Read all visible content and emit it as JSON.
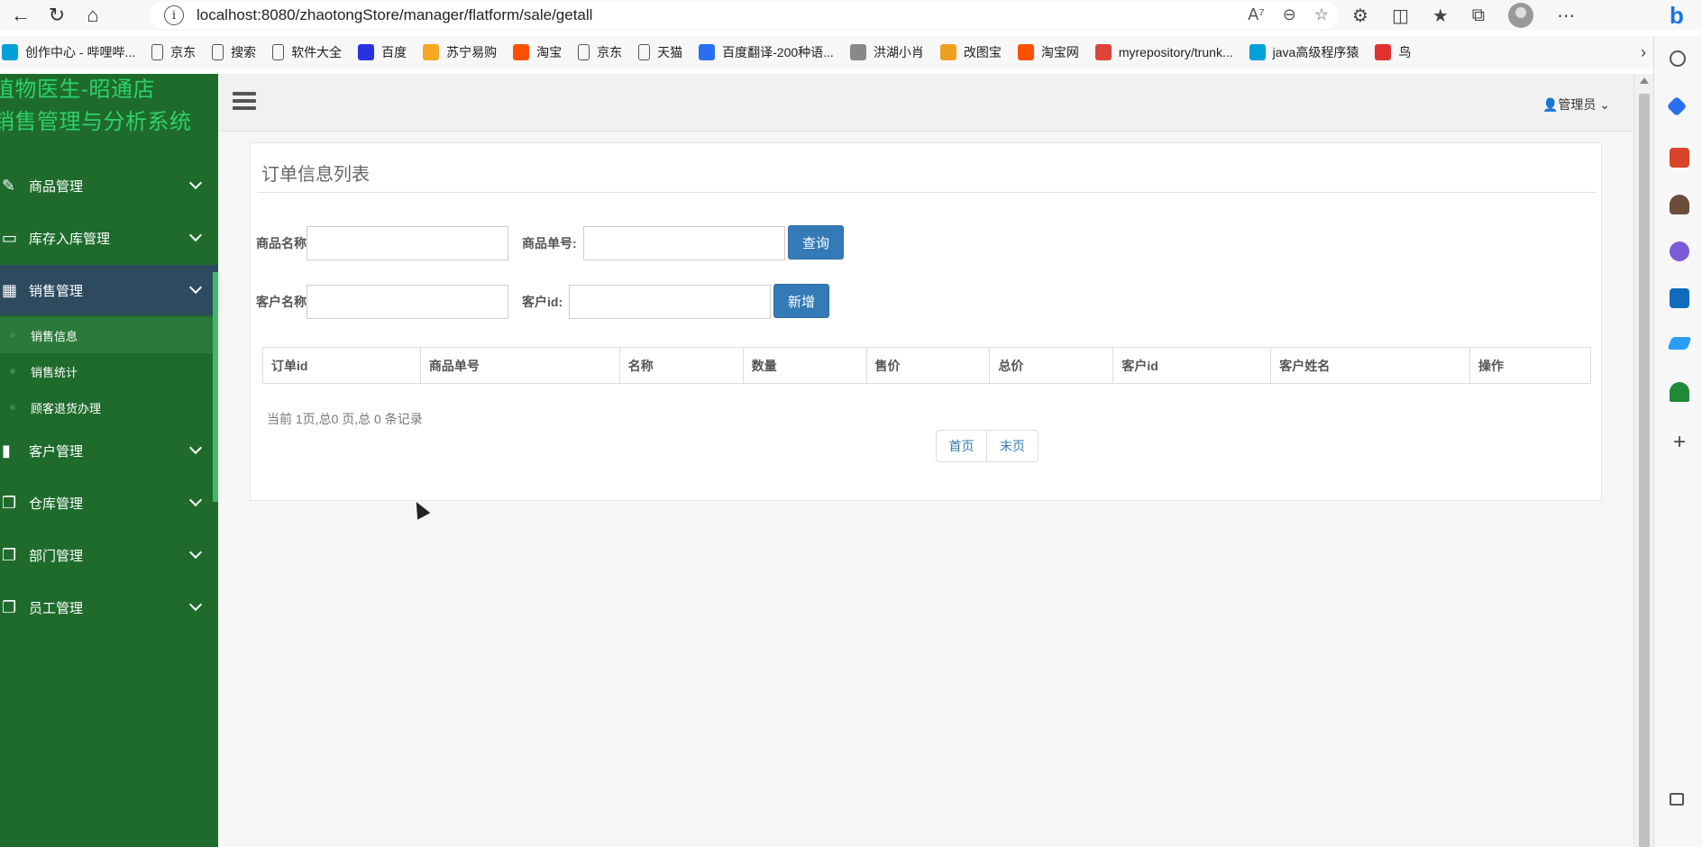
{
  "browser": {
    "url": "localhost:8080/zhaotongStore/manager/flatform/sale/getall",
    "bookmarks": [
      {
        "label": "创作中心 - 哔哩哔...",
        "icon": "bilibili-icon",
        "color": "#00a1d6"
      },
      {
        "label": "京东",
        "icon": "page-icon",
        "color": ""
      },
      {
        "label": "搜索",
        "icon": "page-icon",
        "color": ""
      },
      {
        "label": "软件大全",
        "icon": "page-icon",
        "color": ""
      },
      {
        "label": "百度",
        "icon": "baidu-icon",
        "color": "#2932e1"
      },
      {
        "label": "苏宁易购",
        "icon": "suning-icon",
        "color": "#f5a623"
      },
      {
        "label": "淘宝",
        "icon": "taobao-icon",
        "color": "#ff5000"
      },
      {
        "label": "京东",
        "icon": "page-icon",
        "color": ""
      },
      {
        "label": "天猫",
        "icon": "page-icon",
        "color": ""
      },
      {
        "label": "百度翻译-200种语...",
        "icon": "translate-icon",
        "color": "#2a6ff0"
      },
      {
        "label": "洪湖小肖",
        "icon": "bird-icon",
        "color": "#888888"
      },
      {
        "label": "改图宝",
        "icon": "gaitubao-icon",
        "color": "#f0a020"
      },
      {
        "label": "淘宝网",
        "icon": "taobao-icon",
        "color": "#ff5000"
      },
      {
        "label": "myrepository/trunk...",
        "icon": "chrome-icon",
        "color": "#db4437"
      },
      {
        "label": "java高级程序猿",
        "icon": "bilibili-icon",
        "color": "#00a1d6"
      },
      {
        "label": "鸟",
        "icon": "bird-red-icon",
        "color": "#e03030"
      }
    ]
  },
  "app": {
    "brand_line1": "植物医生-昭通店",
    "brand_line2": "销售管理与分析系统",
    "menu": [
      {
        "label": "商品管理",
        "icon": "edit-icon"
      },
      {
        "label": "库存入库管理",
        "icon": "monitor-icon"
      },
      {
        "label": "销售管理",
        "icon": "table-icon"
      },
      {
        "label": "客户管理",
        "icon": "bar-chart-icon"
      },
      {
        "label": "仓库管理",
        "icon": "copy-icon"
      },
      {
        "label": "部门管理",
        "icon": "copy-icon"
      },
      {
        "label": "员工管理",
        "icon": "copy-icon"
      }
    ],
    "submenu": [
      "销售信息",
      "销售统计",
      "顾客退货办理"
    ],
    "user": "管理员"
  },
  "page": {
    "title": "订单信息列表",
    "form": {
      "product_name_label": "商品名称:",
      "product_no_label": "商品单号:",
      "query_button": "查询",
      "customer_name_label": "客户名称:",
      "customer_id_label": "客户id:",
      "add_button": "新增",
      "product_name_value": "",
      "product_no_value": "",
      "customer_name_value": "",
      "customer_id_value": ""
    },
    "table_headers": [
      "订单id",
      "商品单号",
      "名称",
      "数量",
      "售价",
      "总价",
      "客户id",
      "客户姓名",
      "操作"
    ],
    "table_rows": [],
    "pager_info": "当前 1页,总0 页,总 0 条记录",
    "first_page": "首页",
    "last_page": "末页"
  }
}
